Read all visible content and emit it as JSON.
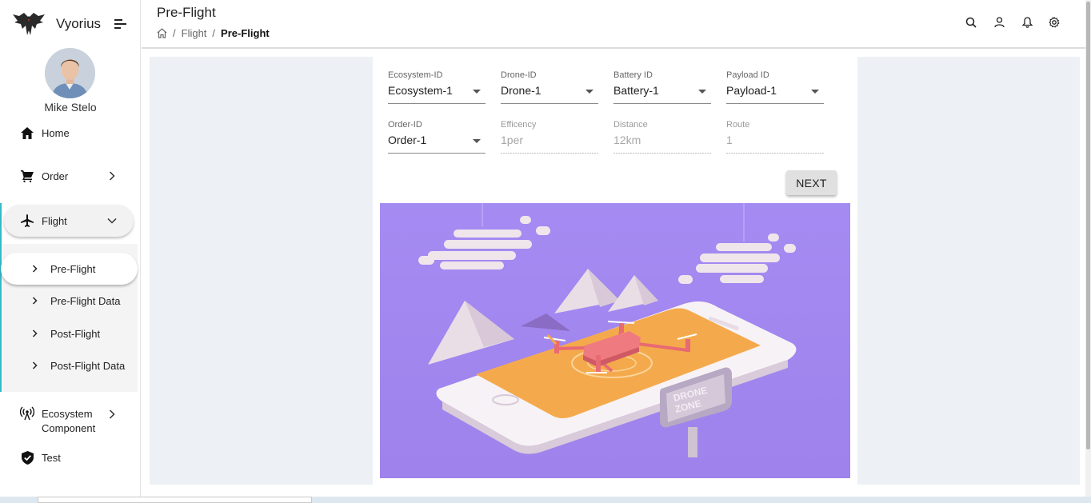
{
  "brand": {
    "name": "Vyorius"
  },
  "user": {
    "name": "Mike Stelo"
  },
  "sidebar": {
    "items": [
      {
        "label": "Home",
        "icon": "home-icon"
      },
      {
        "label": "Order",
        "icon": "cart-icon"
      },
      {
        "label": "Flight",
        "icon": "airplane-icon"
      },
      {
        "label": "Ecosystem\nComponent",
        "icon": "antenna-icon"
      },
      {
        "label": "Test",
        "icon": "shield-check-icon"
      }
    ],
    "flight_submenu": [
      {
        "label": "Pre-Flight",
        "active": true
      },
      {
        "label": "Pre-Flight Data"
      },
      {
        "label": "Post-Flight"
      },
      {
        "label": "Post-Flight Data"
      }
    ]
  },
  "header": {
    "title": "Pre-Flight",
    "breadcrumb": {
      "parent": "Flight",
      "current": "Pre-Flight",
      "separator": "/"
    },
    "icons": [
      "search-icon",
      "user-icon",
      "bell-icon",
      "gear-icon"
    ]
  },
  "form": {
    "ecosystem": {
      "label": "Ecosystem-ID",
      "value": "Ecosystem-1"
    },
    "drone": {
      "label": "Drone-ID",
      "value": "Drone-1"
    },
    "battery": {
      "label": "Battery ID",
      "value": "Battery-1"
    },
    "payload": {
      "label": "Payload ID",
      "value": "Payload-1"
    },
    "order": {
      "label": "Order-ID",
      "value": "Order-1"
    },
    "efficiency": {
      "label": "Efficency",
      "value": "1per"
    },
    "distance": {
      "label": "Distance",
      "value": "12km"
    },
    "route": {
      "label": "Route",
      "value": "1"
    },
    "next_label": "NEXT"
  },
  "illustration": {
    "sign_line1": "DRONE",
    "sign_line2": "ZONE"
  },
  "colors": {
    "accent": "#35b9c9",
    "illustration_bg": "#a387f0",
    "screen": "#f4aa4c",
    "drone": "#e86a72"
  }
}
